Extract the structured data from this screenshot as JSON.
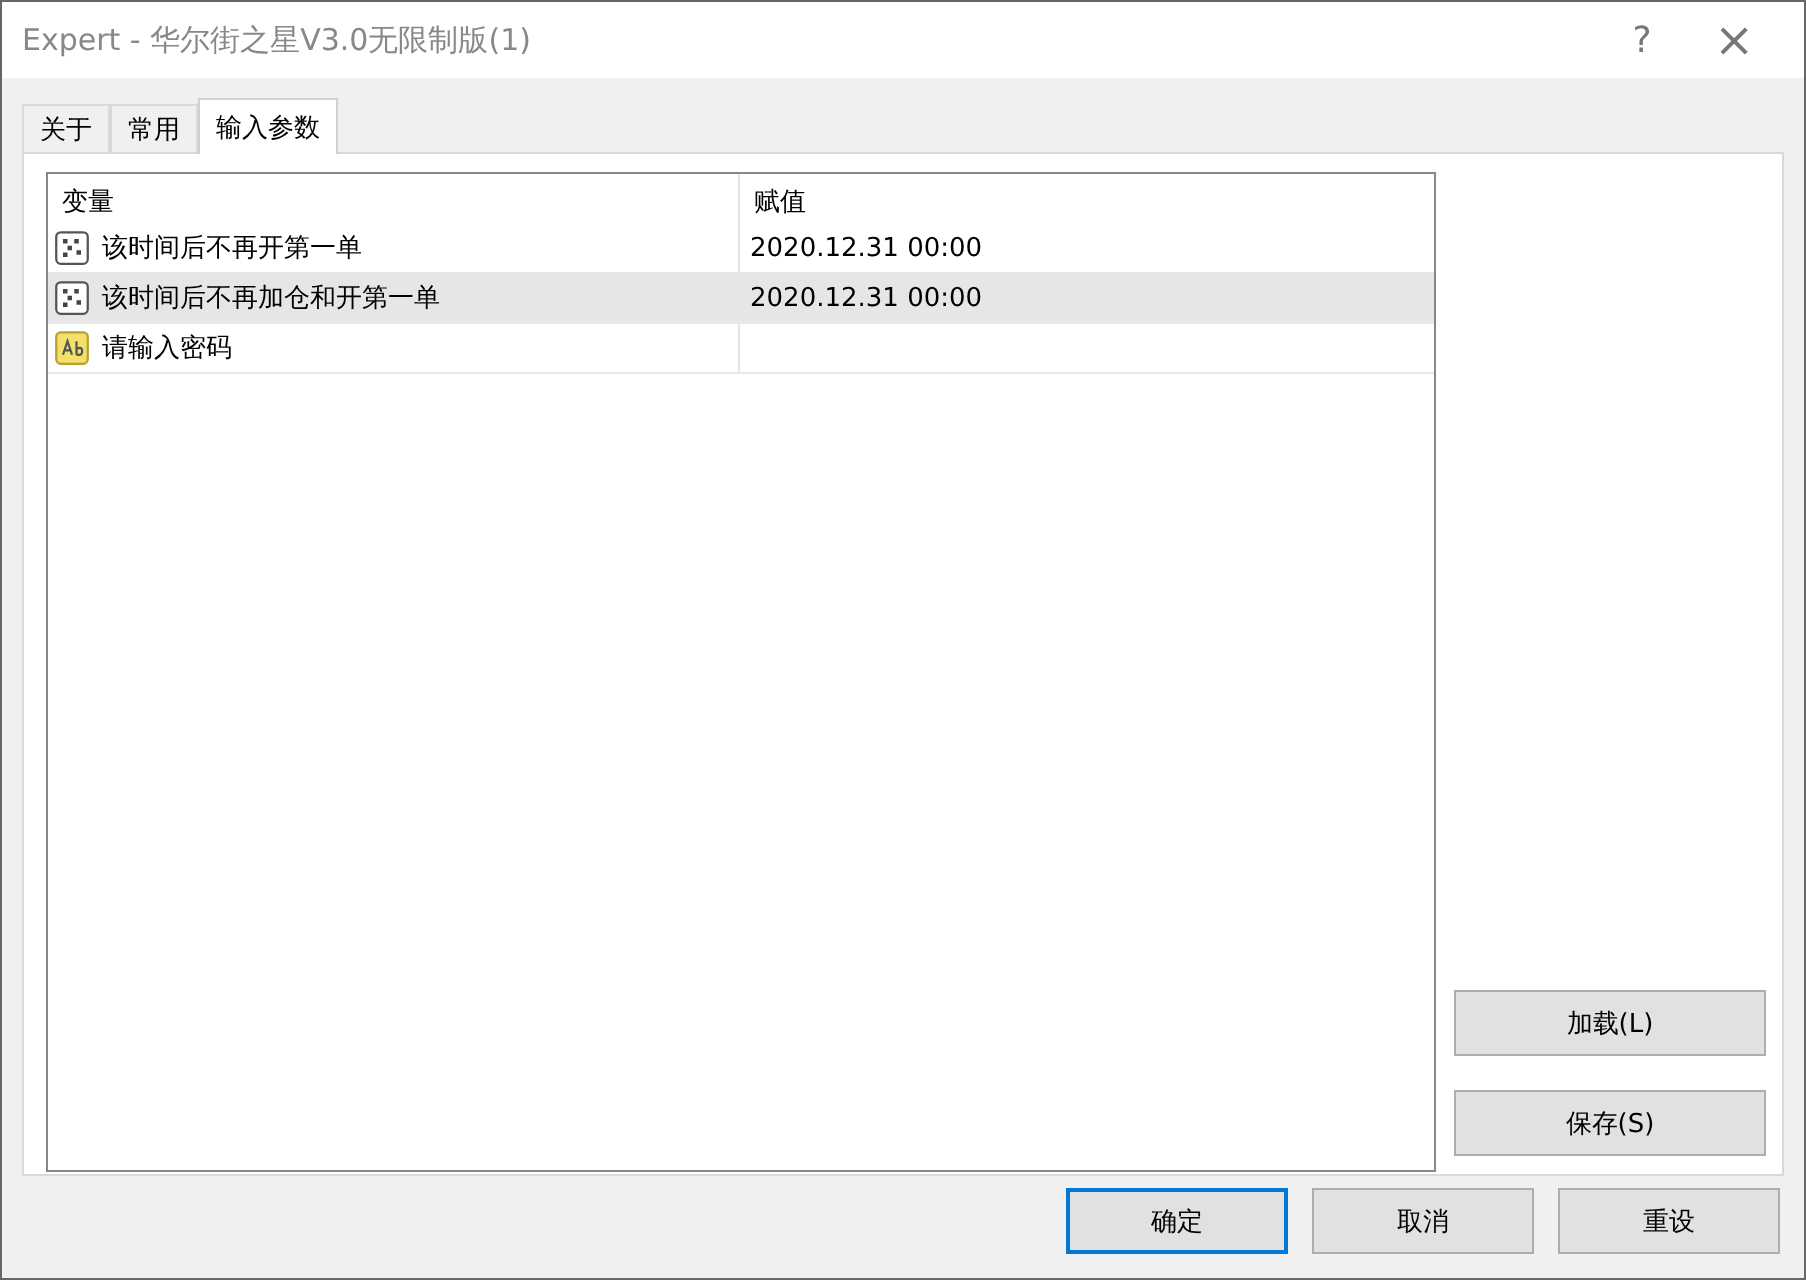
{
  "window": {
    "title": "Expert - 华尔街之星V3.0无限制版(1)",
    "help": "?",
    "close": "×"
  },
  "tabs": [
    {
      "label": "关于",
      "selected": false
    },
    {
      "label": "常用",
      "selected": false
    },
    {
      "label": "输入参数",
      "selected": true
    }
  ],
  "table": {
    "columns": [
      "变量",
      "赋值"
    ],
    "rows": [
      {
        "kind": "datetime",
        "name": "该时间后不再开第一单",
        "value": "2020.12.31 00:00",
        "selected": false
      },
      {
        "kind": "datetime",
        "name": "该时间后不再加仓和开第一单",
        "value": "2020.12.31 00:00",
        "selected": true
      },
      {
        "kind": "string",
        "name": "请输入密码",
        "selected": false
      }
    ]
  },
  "side_buttons": [
    "加载(L)",
    "保存(S)"
  ],
  "buttons": [
    {
      "label": "确定",
      "default": true
    },
    {
      "label": "取消",
      "default": false
    },
    {
      "label": "重设",
      "default": false
    }
  ]
}
